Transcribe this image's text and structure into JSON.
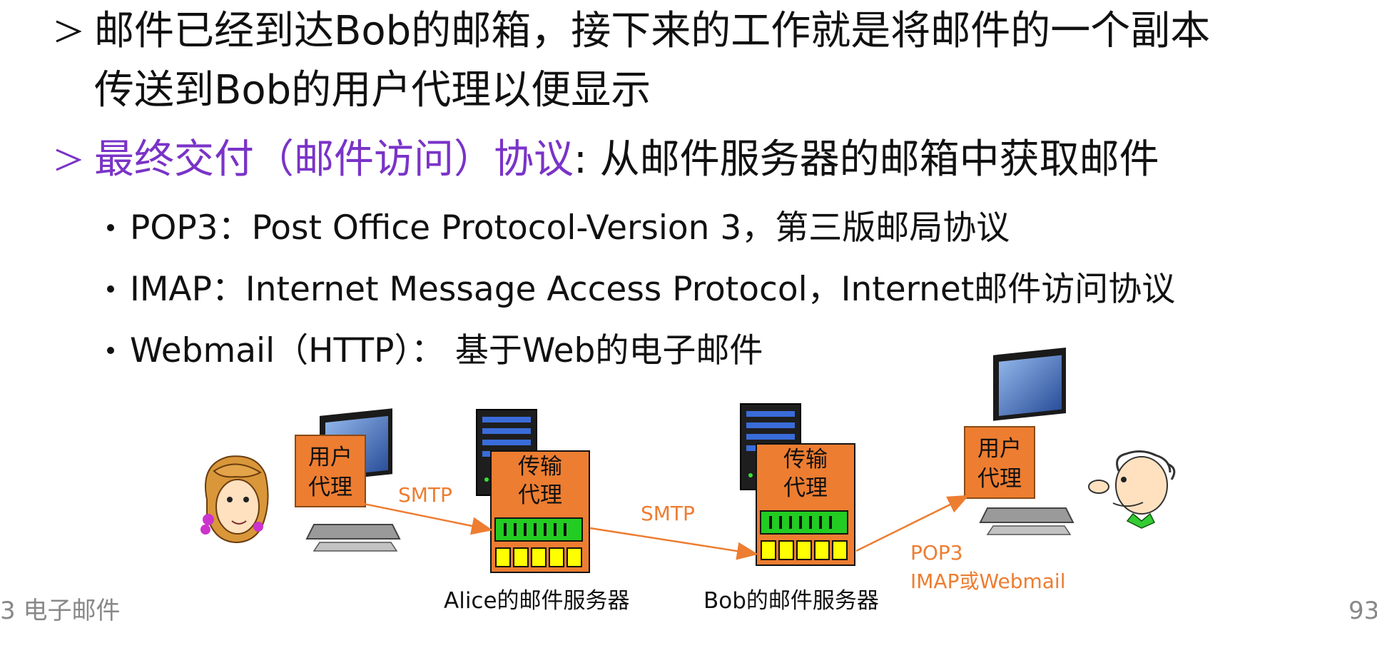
{
  "content": {
    "bullet1": {
      "line1": "邮件已经到达Bob的邮箱，接下来的工作就是将邮件的一个副本",
      "line2": "传送到Bob的用户代理以便显示"
    },
    "bullet2": {
      "highlight": "最终交付（邮件访问）协议",
      "rest": ": 从邮件服务器的邮箱中获取邮件"
    },
    "sub_bullets": [
      "POP3：Post Office Protocol-Version 3，第三版邮局协议",
      "IMAP：Internet Message Access Protocol，Internet邮件访问协议",
      "Webmail（HTTP）： 基于Web的电子邮件"
    ]
  },
  "diagram": {
    "ua_left": {
      "line1": "用户",
      "line2": "代理"
    },
    "mta_alice": {
      "line1": "传输",
      "line2": "代理"
    },
    "mta_bob": {
      "line1": "传输",
      "line2": "代理"
    },
    "ua_right": {
      "line1": "用户",
      "line2": "代理"
    },
    "arrow1_label": "SMTP",
    "arrow2_label": "SMTP",
    "arrow3_label_line1": "POP3",
    "arrow3_label_line2": "IMAP或Webmail",
    "alice_server_label": "Alice的邮件服务器",
    "bob_server_label": "Bob的邮件服务器"
  },
  "footer": {
    "section": "3 电子邮件",
    "page": "93"
  },
  "colors": {
    "accent_orange": "#ed7d31",
    "purple": "#7a33c7",
    "queue_green": "#22cc22",
    "queue_yellow": "#ffff00",
    "footer_gray": "#888888"
  }
}
